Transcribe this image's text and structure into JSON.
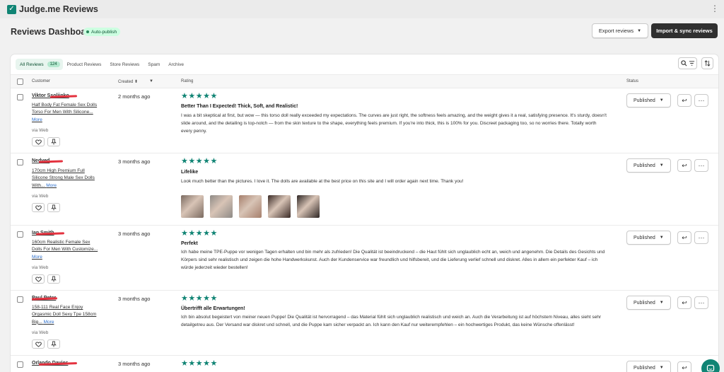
{
  "app": {
    "title": "Judge.me Reviews",
    "logo_icon": "check-logo-icon",
    "menu_icon": "kebab-icon"
  },
  "header": {
    "title": "Reviews Dashboard",
    "badge": "Auto-publish",
    "export_label": "Export reviews",
    "import_label": "Import & sync reviews"
  },
  "tabs": [
    {
      "label": "All Reviews",
      "count": "124"
    },
    {
      "label": "Product Reviews"
    },
    {
      "label": "Store Reviews"
    },
    {
      "label": "Spam"
    },
    {
      "label": "Archive"
    }
  ],
  "columns": {
    "customer": "Customer",
    "created": "Created",
    "rating": "Rating",
    "status": "Status"
  },
  "reviews": [
    {
      "customer": "Viktor Ssoliinko",
      "product": "Half Body Fat Female Sex Dolls Torso For Men With Silicone...",
      "more": "More",
      "source": "via Web",
      "created": "2 months ago",
      "stars": "★★★★★",
      "rating": 5,
      "title": "Better Than I Expected! Thick, Soft, and Realistic!",
      "body": "I was a bit skeptical at first, but wow — this torso doll really exceeded my expectations. The curves are just right, the softness feels amazing, and the weight gives it a real, satisfying presence. It's sturdy, doesn't slide around, and the detailing is top-notch — from the skin texture to the shape, everything feels premium. If you're into thick, this is 100% for you. Discreet packaging too, so no worries there. Totally worth every penny.",
      "status": "Published"
    },
    {
      "customer": "Nedved",
      "product": "170cm High Premium Full Silicone Strong Male Sex Dolls With...",
      "more": "More",
      "source": "via Web",
      "created": "3 months ago",
      "stars": "★★★★★",
      "rating": 5,
      "title": "Lifelike",
      "body": "Look much better than the pictures. I love it. The dolls are available at the best price on this site and I will order again next time. Thank you!",
      "status": "Published"
    },
    {
      "customer": "Ian Smith",
      "product": "160cm Realistic Female Sex Dolls For Men With Customize...",
      "more": "More",
      "source": "via Web",
      "created": "3 months ago",
      "stars": "★★★★★",
      "rating": 5,
      "title": "Perfekt",
      "body": "Ich habe meine TPE-Puppe vor wenigen Tagen erhalten und bin mehr als zufrieden! Die Qualität ist beeindruckend – die Haut fühlt sich unglaublich echt an, weich und angenehm. Die Details des Gesichts und Körpers sind sehr realistisch und zeigen die hohe Handwerkskunst. Auch der Kundenservice war freundlich und hilfsbereit, und die Lieferung verlief schnell und diskret. Alles in allem ein perfekter Kauf – ich würde jederzeit wieder bestellen!",
      "status": "Published"
    },
    {
      "customer": "Paul Peter",
      "product": "158-111 Real Face Enjoy Orgasmic Doll Sexy Tpe 158cm Big...",
      "more": "More",
      "source": "via Web",
      "created": "3 months ago",
      "stars": "★★★★★",
      "rating": 5,
      "title": "Übertrifft alle Erwartungen!",
      "body": "Ich bin absolut begeistert von meiner neuen Puppe! Die Qualität ist hervorragend – das Material fühlt sich unglaublich realistisch und weich an. Auch die Verarbeitung ist auf höchstem Niveau, alles sieht sehr detailgetreu aus. Der Versand war diskret und schnell, und die Puppe kam sicher verpackt an. Ich kann den Kauf nur weiterempfehlen – ein hochwertiges Produkt, das keine Wünsche offenlässt!",
      "status": "Published"
    },
    {
      "customer": "Orlando Davies",
      "created": "3 months ago",
      "stars": "★★★★★",
      "rating": 5,
      "status": "Published"
    }
  ],
  "thumb_colors": [
    "#7a6a60",
    "#8e8a86",
    "#a67f6c",
    "#3a2a26",
    "#2e2624"
  ],
  "colors": {
    "accent": "#108474",
    "redaction": "#e4323f",
    "primary_button": "#303030",
    "badge_bg": "#cdfee1"
  },
  "icons": [
    "search-icon",
    "filter-icon",
    "sort-icon",
    "heart-icon",
    "pin-icon",
    "reply-icon",
    "more-icon",
    "chat-icon"
  ]
}
